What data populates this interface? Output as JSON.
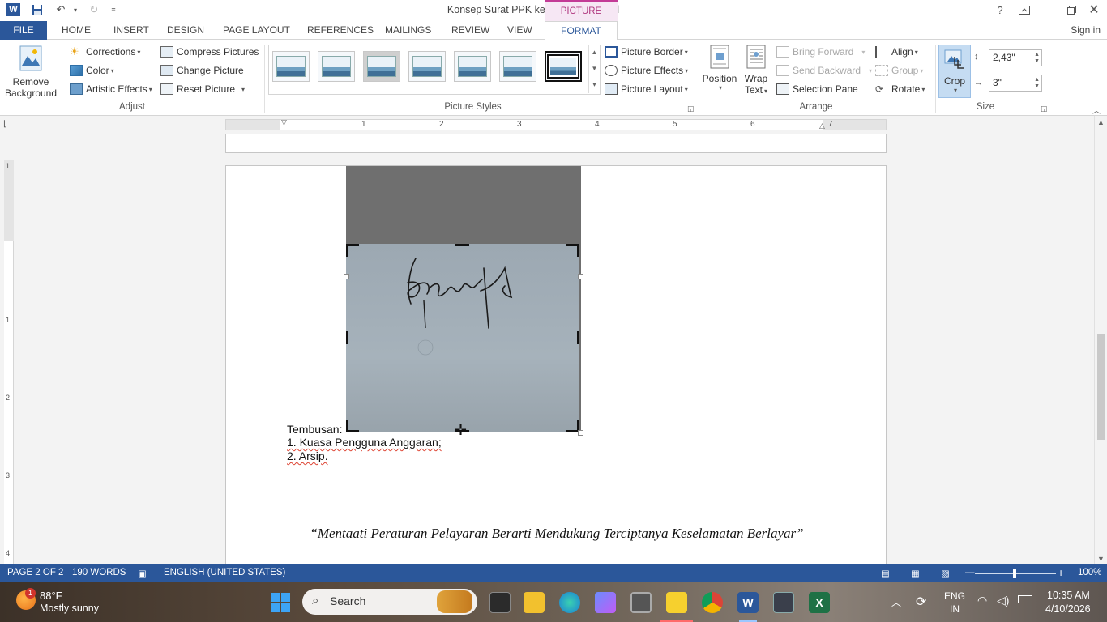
{
  "window": {
    "title": "Konsep Surat PPK ke PP Final - Word",
    "context_tab": "PICTURE TOOLS",
    "signin": "Sign in",
    "help": "?"
  },
  "tabs": [
    "FILE",
    "HOME",
    "INSERT",
    "DESIGN",
    "PAGE LAYOUT",
    "REFERENCES",
    "MAILINGS",
    "REVIEW",
    "VIEW",
    "FORMAT"
  ],
  "ribbon": {
    "adjust": {
      "label": "Adjust",
      "remove_background": "Remove Background",
      "remove_background_l1": "Remove",
      "remove_background_l2": "Background",
      "corrections": "Corrections",
      "color": "Color",
      "artistic_effects": "Artistic Effects",
      "compress": "Compress Pictures",
      "change": "Change Picture",
      "reset": "Reset Picture"
    },
    "styles": {
      "label": "Picture Styles",
      "border": "Picture Border",
      "effects": "Picture Effects",
      "layout": "Picture Layout"
    },
    "arrange": {
      "label": "Arrange",
      "position": "Position",
      "wrap_l1": "Wrap",
      "wrap_l2": "Text",
      "bring_forward": "Bring Forward",
      "send_backward": "Send Backward",
      "selection_pane": "Selection Pane",
      "align": "Align",
      "group": "Group",
      "rotate": "Rotate"
    },
    "size": {
      "label": "Size",
      "crop": "Crop",
      "height": "2,43\"",
      "width": "3\""
    }
  },
  "ruler": {
    "h_numbers": [
      "1",
      "2",
      "3",
      "4",
      "5",
      "6",
      "7"
    ],
    "v_numbers": [
      "1",
      "1",
      "2",
      "3",
      "4"
    ]
  },
  "document": {
    "tembusan": "Tembusan:",
    "item1": "1. Kuasa Pengguna Anggaran;",
    "item2": "2. Arsip.",
    "motto": "“Mentaati Peraturan Pelayaran Berarti Mendukung Terciptanya Keselamatan Berlayar”"
  },
  "status": {
    "page": "PAGE 2 OF 2",
    "words": "190 WORDS",
    "language": "ENGLISH (UNITED STATES)",
    "zoom": "100%"
  },
  "taskbar": {
    "weather_temp": "88°F",
    "weather_desc": "Mostly sunny",
    "weather_badge": "1",
    "search": "Search",
    "lang1": "ENG",
    "lang2": "IN",
    "time": "10:35 AM",
    "date": "4/10/2026"
  }
}
